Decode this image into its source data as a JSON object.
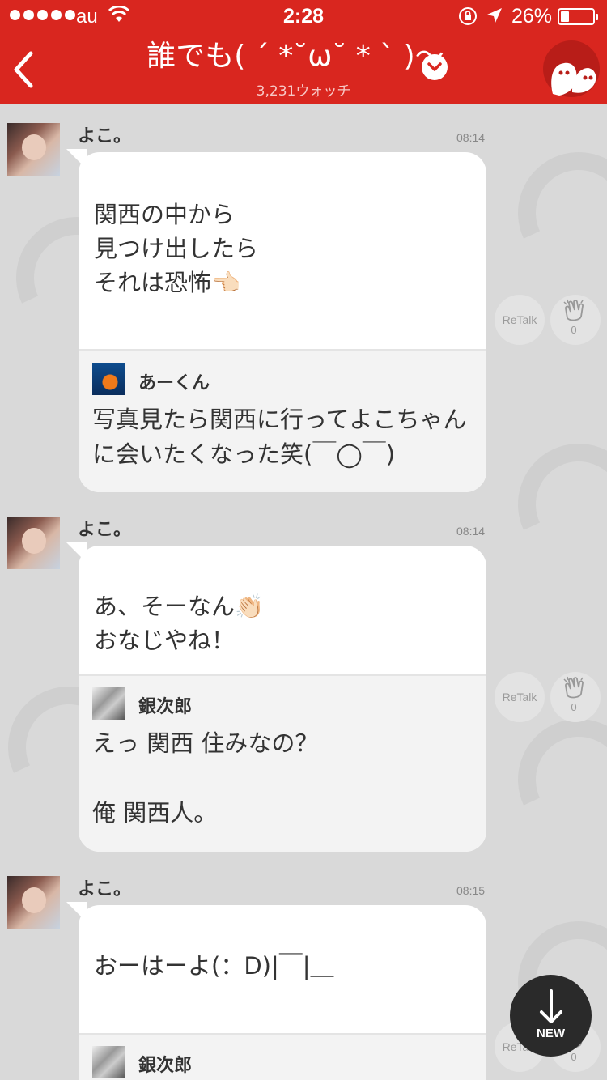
{
  "status": {
    "carrier": "au",
    "time": "2:28",
    "battery": "26%"
  },
  "nav": {
    "title": "誰でも( ´ *˘ω˘ * ` )～",
    "subtitle": "3,231ウォッチ"
  },
  "messages": [
    {
      "user": "よこ。",
      "time": "08:14",
      "text": "関西の中から\n見つけ出したら\nそれは恐怖👈🏻",
      "quote_user": "あーくん",
      "quote_text": "写真見たら関西に行ってよこちゃんに会いたくなった笑(￣◯￣)",
      "retalk_label": "ReTalk",
      "clap_count": "0"
    },
    {
      "user": "よこ。",
      "time": "08:14",
      "text": "あ、そーなん👏🏻\nおなじやね！",
      "quote_user": "銀次郎",
      "quote_text": "えっ 関西 住みなの？\n\n俺 関西人。",
      "retalk_label": "ReTalk",
      "clap_count": "0"
    },
    {
      "user": "よこ。",
      "time": "08:15",
      "text": "おーはーよ(：D)|￣|＿",
      "quote_user": "銀次郎",
      "retalk_label": "ReTalk",
      "clap_count": "0"
    }
  ],
  "new_button": {
    "label": "NEW"
  },
  "colors": {
    "brand_red": "#d9261f",
    "background": "#d9d9d9"
  }
}
